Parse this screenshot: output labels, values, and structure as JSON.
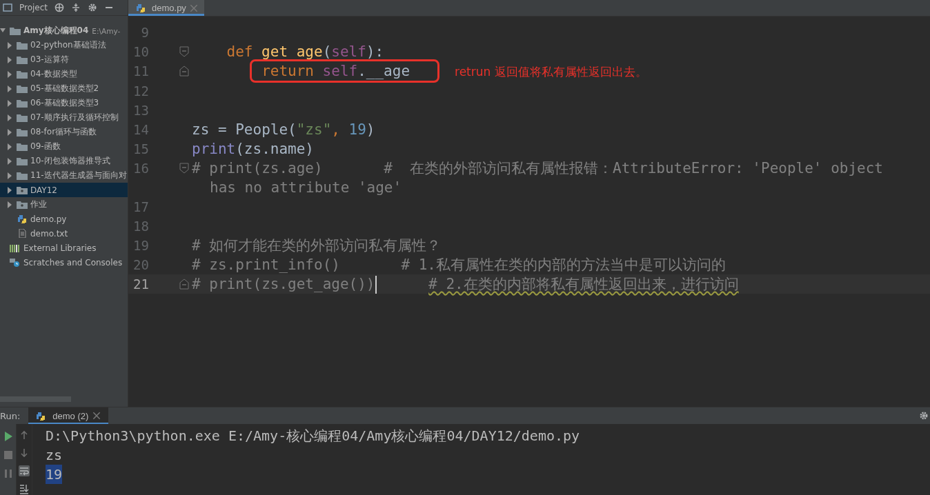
{
  "project_panel": {
    "title": "Project",
    "tree": [
      {
        "label": "Amy核心编程04",
        "path": "E:\\Amy-",
        "kind": "folder",
        "expanded": true,
        "selected": false,
        "children": [
          {
            "label": "02-python基础语法",
            "kind": "folder",
            "expanded": false,
            "selected": false
          },
          {
            "label": "03-运算符",
            "kind": "folder",
            "expanded": false,
            "selected": false
          },
          {
            "label": "04-数据类型",
            "kind": "folder",
            "expanded": false,
            "selected": false
          },
          {
            "label": "05-基础数据类型2",
            "kind": "folder",
            "expanded": false,
            "selected": false
          },
          {
            "label": "06-基础数据类型3",
            "kind": "folder",
            "expanded": false,
            "selected": false
          },
          {
            "label": "07-顺序执行及循环控制",
            "kind": "folder",
            "expanded": false,
            "selected": false
          },
          {
            "label": "08-for循环与函数",
            "kind": "folder",
            "expanded": false,
            "selected": false
          },
          {
            "label": "09-函数",
            "kind": "folder",
            "expanded": false,
            "selected": false
          },
          {
            "label": "10-闭包装饰器推导式",
            "kind": "folder",
            "expanded": false,
            "selected": false
          },
          {
            "label": "11-迭代器生成器与面向对",
            "kind": "folder",
            "expanded": false,
            "selected": false
          },
          {
            "label": "DAY12",
            "kind": "package",
            "expanded": false,
            "selected": true
          },
          {
            "label": "作业",
            "kind": "package",
            "expanded": false,
            "selected": false
          },
          {
            "label": "demo.py",
            "kind": "python",
            "selected": false
          },
          {
            "label": "demo.txt",
            "kind": "text",
            "selected": false
          }
        ]
      },
      {
        "label": "External Libraries",
        "kind": "libraries",
        "selected": false
      },
      {
        "label": "Scratches and Consoles",
        "kind": "scratches",
        "selected": false
      }
    ]
  },
  "editor": {
    "tabs": [
      {
        "label": "demo.py",
        "selected": true
      }
    ],
    "lines": [
      {
        "number": "9"
      },
      {
        "number": "10",
        "fold_start": true,
        "tokens": [
          {
            "text": "    def",
            "kind": "keyword"
          },
          {
            "text": "get_age",
            "kind": "function"
          },
          {
            "text": "(",
            "kind": "plain"
          },
          {
            "text": "self",
            "kind": "self"
          },
          {
            "text": "):",
            "kind": "plain"
          }
        ]
      },
      {
        "number": "11",
        "fold_end": true,
        "highlighted": true,
        "tokens": [
          {
            "text": "return",
            "kind": "keyword"
          },
          {
            "text": "self",
            "kind": "self"
          },
          {
            "text": ".__age",
            "kind": "plain"
          }
        ],
        "annotation": "retrun 返回值将私有属性返回出去。"
      },
      {
        "number": "12"
      },
      {
        "number": "13"
      },
      {
        "number": "14",
        "tokens": [
          {
            "text": "zs = People(",
            "kind": "plain"
          },
          {
            "text": "\"zs\"",
            "kind": "string"
          },
          {
            "text": ",",
            "kind": "keyword"
          },
          {
            "text": "19",
            "kind": "number"
          },
          {
            "text": ")",
            "kind": "plain"
          }
        ]
      },
      {
        "number": "15",
        "tokens": [
          {
            "text": "print",
            "kind": "builtin"
          },
          {
            "text": "(zs.name)",
            "kind": "plain"
          }
        ]
      },
      {
        "number": "16",
        "fold_start": true,
        "tokens": [
          {
            "text": "# print(zs.age)       #  在类的外部访问私有属性报错：AttributeError: 'People' object",
            "kind": "comment"
          }
        ],
        "wrap": "has no attribute 'age'"
      },
      {
        "number": "17"
      },
      {
        "number": "18"
      },
      {
        "number": "19",
        "tokens": [
          {
            "text": "# 如何才能在类的外部访问私有属性？",
            "kind": "comment"
          }
        ]
      },
      {
        "number": "20",
        "tokens": [
          {
            "text": "# zs.print_info()       # 1.私有属性在类的内部的方法当中是可以访问的",
            "kind": "comment"
          }
        ]
      },
      {
        "number": "21",
        "fold_end": true,
        "current": true,
        "tokens": [
          {
            "text": "# print(zs.get_age())",
            "kind": "comment"
          },
          {
            "text": "# 2.在类的内部将私有属性返回出来，进行访问",
            "kind": "typo"
          }
        ]
      }
    ]
  },
  "run_panel": {
    "label": "Run:",
    "tabs": [
      {
        "label": "demo (2)",
        "selected": true
      }
    ],
    "output": [
      {
        "text": "D:\\Python3\\python.exe E:/Amy-核心编程04/Amy核心编程04/DAY12/demo.py",
        "selected": false
      },
      {
        "text": "zs",
        "selected": false
      },
      {
        "text": "19",
        "selected": true
      }
    ]
  }
}
